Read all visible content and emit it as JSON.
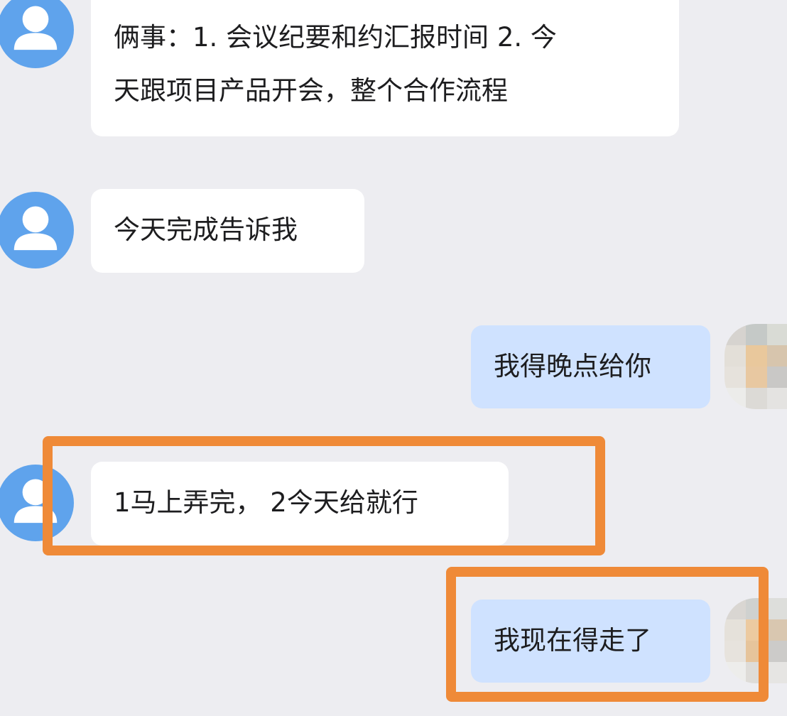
{
  "chat": {
    "messages": [
      {
        "sender": "other",
        "lines": [
          "俩事：1. 会议纪要和约汇报时间 2. 今",
          "天跟项目产品开会，整个合作流程"
        ]
      },
      {
        "sender": "other",
        "lines": [
          "今天完成告诉我"
        ]
      },
      {
        "sender": "self",
        "lines": [
          "我得晚点给你"
        ]
      },
      {
        "sender": "other",
        "lines": [
          "1马上弄完， 2今天给就行"
        ]
      },
      {
        "sender": "self",
        "lines": [
          "我现在得走了"
        ]
      }
    ]
  },
  "icons": {
    "other_avatar": "default-person-avatar-icon",
    "self_avatar": "pixelated-user-avatar"
  },
  "colors": {
    "background": "#ededf1",
    "incoming_bubble": "#ffffff",
    "outgoing_bubble": "#cfe2ff",
    "avatar_blue": "#5fa3ec",
    "highlight_orange": "#ef8a38"
  }
}
